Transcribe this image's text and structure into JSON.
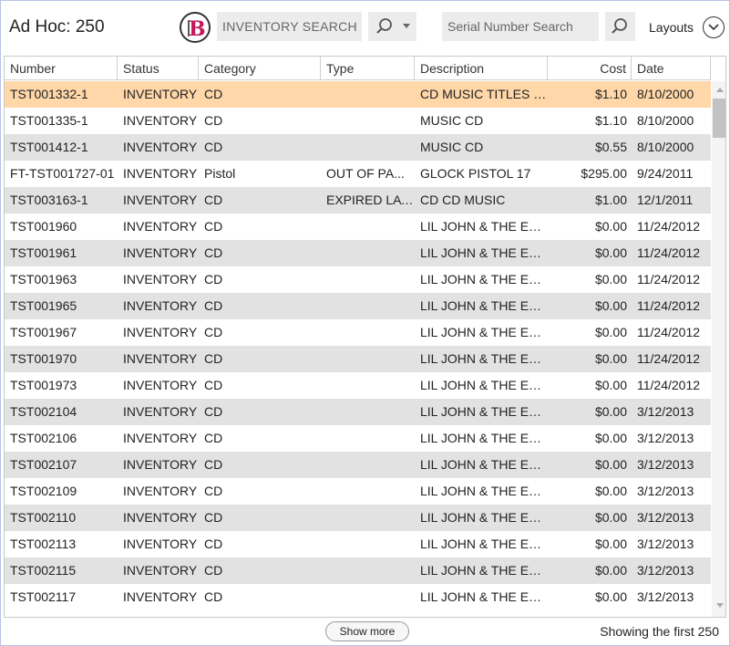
{
  "header": {
    "title": "Ad Hoc: 250",
    "logo_letter": "B",
    "inventory_search_placeholder": "INVENTORY SEARCH",
    "serial_search_placeholder": "Serial Number Search",
    "layouts_label": "Layouts"
  },
  "table": {
    "columns": [
      "Number",
      "Status",
      "Category",
      "Type",
      "Description",
      "Cost",
      "Date"
    ],
    "rows": [
      {
        "number": "TST001332-1",
        "status": "INVENTORY",
        "category": "CD",
        "type": "",
        "description": "CD MUSIC TITLES C...",
        "cost": "$1.10",
        "date": "8/10/2000"
      },
      {
        "number": "TST001335-1",
        "status": "INVENTORY",
        "category": "CD",
        "type": "",
        "description": "MUSIC CD",
        "cost": "$1.10",
        "date": "8/10/2000"
      },
      {
        "number": "TST001412-1",
        "status": "INVENTORY",
        "category": "CD",
        "type": "",
        "description": "MUSIC CD",
        "cost": "$0.55",
        "date": "8/10/2000"
      },
      {
        "number": "FT-TST001727-01",
        "status": "INVENTORY",
        "category": "Pistol",
        "type": "OUT OF PA...",
        "description": "GLOCK PISTOL 17",
        "cost": "$295.00",
        "date": "9/24/2011"
      },
      {
        "number": "TST003163-1",
        "status": "INVENTORY",
        "category": "CD",
        "type": "EXPIRED LAY...",
        "description": "CD CD MUSIC",
        "cost": "$1.00",
        "date": "12/1/2011"
      },
      {
        "number": "TST001960",
        "status": "INVENTORY",
        "category": "CD",
        "type": "",
        "description": "LIL JOHN & THE EA...",
        "cost": "$0.00",
        "date": "11/24/2012"
      },
      {
        "number": "TST001961",
        "status": "INVENTORY",
        "category": "CD",
        "type": "",
        "description": "LIL JOHN & THE EA...",
        "cost": "$0.00",
        "date": "11/24/2012"
      },
      {
        "number": "TST001963",
        "status": "INVENTORY",
        "category": "CD",
        "type": "",
        "description": "LIL JOHN & THE EA...",
        "cost": "$0.00",
        "date": "11/24/2012"
      },
      {
        "number": "TST001965",
        "status": "INVENTORY",
        "category": "CD",
        "type": "",
        "description": "LIL JOHN & THE EA...",
        "cost": "$0.00",
        "date": "11/24/2012"
      },
      {
        "number": "TST001967",
        "status": "INVENTORY",
        "category": "CD",
        "type": "",
        "description": "LIL JOHN & THE EA...",
        "cost": "$0.00",
        "date": "11/24/2012"
      },
      {
        "number": "TST001970",
        "status": "INVENTORY",
        "category": "CD",
        "type": "",
        "description": "LIL JOHN & THE EA...",
        "cost": "$0.00",
        "date": "11/24/2012"
      },
      {
        "number": "TST001973",
        "status": "INVENTORY",
        "category": "CD",
        "type": "",
        "description": "LIL JOHN & THE EA...",
        "cost": "$0.00",
        "date": "11/24/2012"
      },
      {
        "number": "TST002104",
        "status": "INVENTORY",
        "category": "CD",
        "type": "",
        "description": "LIL JOHN & THE EA...",
        "cost": "$0.00",
        "date": "3/12/2013"
      },
      {
        "number": "TST002106",
        "status": "INVENTORY",
        "category": "CD",
        "type": "",
        "description": "LIL JOHN & THE EA...",
        "cost": "$0.00",
        "date": "3/12/2013"
      },
      {
        "number": "TST002107",
        "status": "INVENTORY",
        "category": "CD",
        "type": "",
        "description": "LIL JOHN & THE EA...",
        "cost": "$0.00",
        "date": "3/12/2013"
      },
      {
        "number": "TST002109",
        "status": "INVENTORY",
        "category": "CD",
        "type": "",
        "description": "LIL JOHN & THE EA...",
        "cost": "$0.00",
        "date": "3/12/2013"
      },
      {
        "number": "TST002110",
        "status": "INVENTORY",
        "category": "CD",
        "type": "",
        "description": "LIL JOHN & THE EA...",
        "cost": "$0.00",
        "date": "3/12/2013"
      },
      {
        "number": "TST002113",
        "status": "INVENTORY",
        "category": "CD",
        "type": "",
        "description": "LIL JOHN & THE EA...",
        "cost": "$0.00",
        "date": "3/12/2013"
      },
      {
        "number": "TST002115",
        "status": "INVENTORY",
        "category": "CD",
        "type": "",
        "description": "LIL JOHN & THE EA...",
        "cost": "$0.00",
        "date": "3/12/2013"
      },
      {
        "number": "TST002117",
        "status": "INVENTORY",
        "category": "CD",
        "type": "",
        "description": "LIL JOHN & THE EA...",
        "cost": "$0.00",
        "date": "3/12/2013"
      }
    ]
  },
  "footer": {
    "show_more_label": "Show more",
    "showing_text": "Showing the first 250"
  },
  "colors": {
    "selected_row": "#ffd7a8",
    "alt_row": "#e2e2e2",
    "logo_accent": "#c2185b"
  },
  "icons": {
    "logo": "b-logo-icon",
    "search": "search-icon",
    "dropdown": "caret-down-icon",
    "layouts": "chevron-down-icon"
  }
}
